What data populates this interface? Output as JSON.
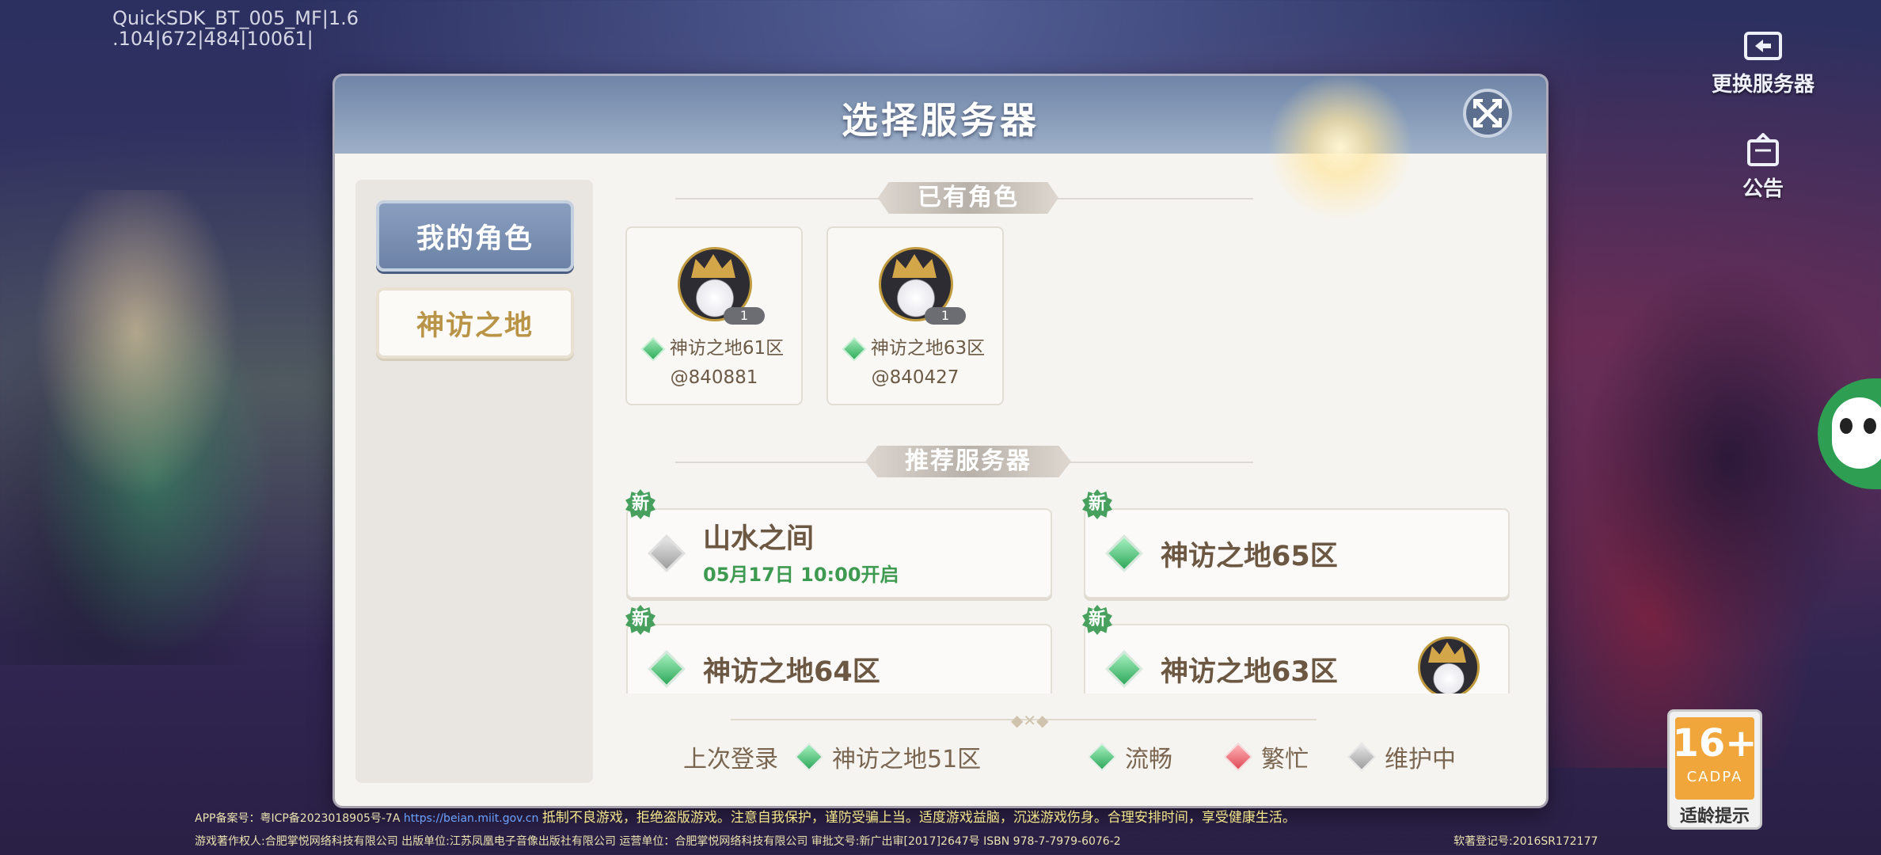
{
  "debug_text": [
    "QuickSDK_BT_005_MF|1.6",
    ".104|672|484|10061|"
  ],
  "side_buttons": {
    "change_server": {
      "label": "更换服务器",
      "icon": "switch-server-icon"
    },
    "notice": {
      "label": "公告",
      "icon": "notice-board-icon"
    }
  },
  "dialog": {
    "title": "选择服务器",
    "close_icon": "close-expand-icon",
    "tabs": [
      {
        "label": "我的角色",
        "active": true
      },
      {
        "label": "神访之地",
        "active": false
      }
    ],
    "existing_section": "已有角色",
    "characters": [
      {
        "level": "1",
        "server": "神访之地61区",
        "id": "@840881"
      },
      {
        "level": "1",
        "server": "神访之地63区",
        "id": "@840427"
      }
    ],
    "recommended_section": "推荐服务器",
    "servers": [
      {
        "badge": "新",
        "name": "山水之间",
        "status": "maintenance",
        "subtext": "05月17日 10:00开启"
      },
      {
        "badge": "新",
        "name": "神访之地65区",
        "status": "smooth"
      },
      {
        "badge": "新",
        "name": "神访之地64区",
        "status": "smooth"
      },
      {
        "badge": "新",
        "name": "神访之地63区",
        "status": "smooth",
        "has_character": true
      }
    ],
    "footer": {
      "last_login_label": "上次登录",
      "last_login_server": "神访之地51区",
      "legend": [
        {
          "label": "流畅",
          "color": "#2ea85a"
        },
        {
          "label": "繁忙",
          "color": "#de4a55"
        },
        {
          "label": "维护中",
          "color": "#9d9d9d"
        }
      ]
    }
  },
  "legal": {
    "line1_prefix": "APP备案号：粤ICP备2023018905号-7A",
    "line1_link": "https://beian.miit.gov.cn",
    "line1_warning": "抵制不良游戏，拒绝盗版游戏。注意自我保护，谨防受骗上当。适度游戏益脑，沉迷游戏伤身。合理安排时间，享受健康生活。",
    "line2": "游戏著作权人:合肥掌悦网络科技有限公司 出版单位:江苏凤凰电子音像出版社有限公司 运营单位：合肥掌悦网络科技有限公司    审批文号:新广出审[2017]2647号  ISBN 978-7-7979-6076-2",
    "line2_right": "软著登记号:2016SR172177"
  },
  "age_rating": {
    "value": "16+",
    "org": "CADPA",
    "tip": "适龄提示"
  }
}
